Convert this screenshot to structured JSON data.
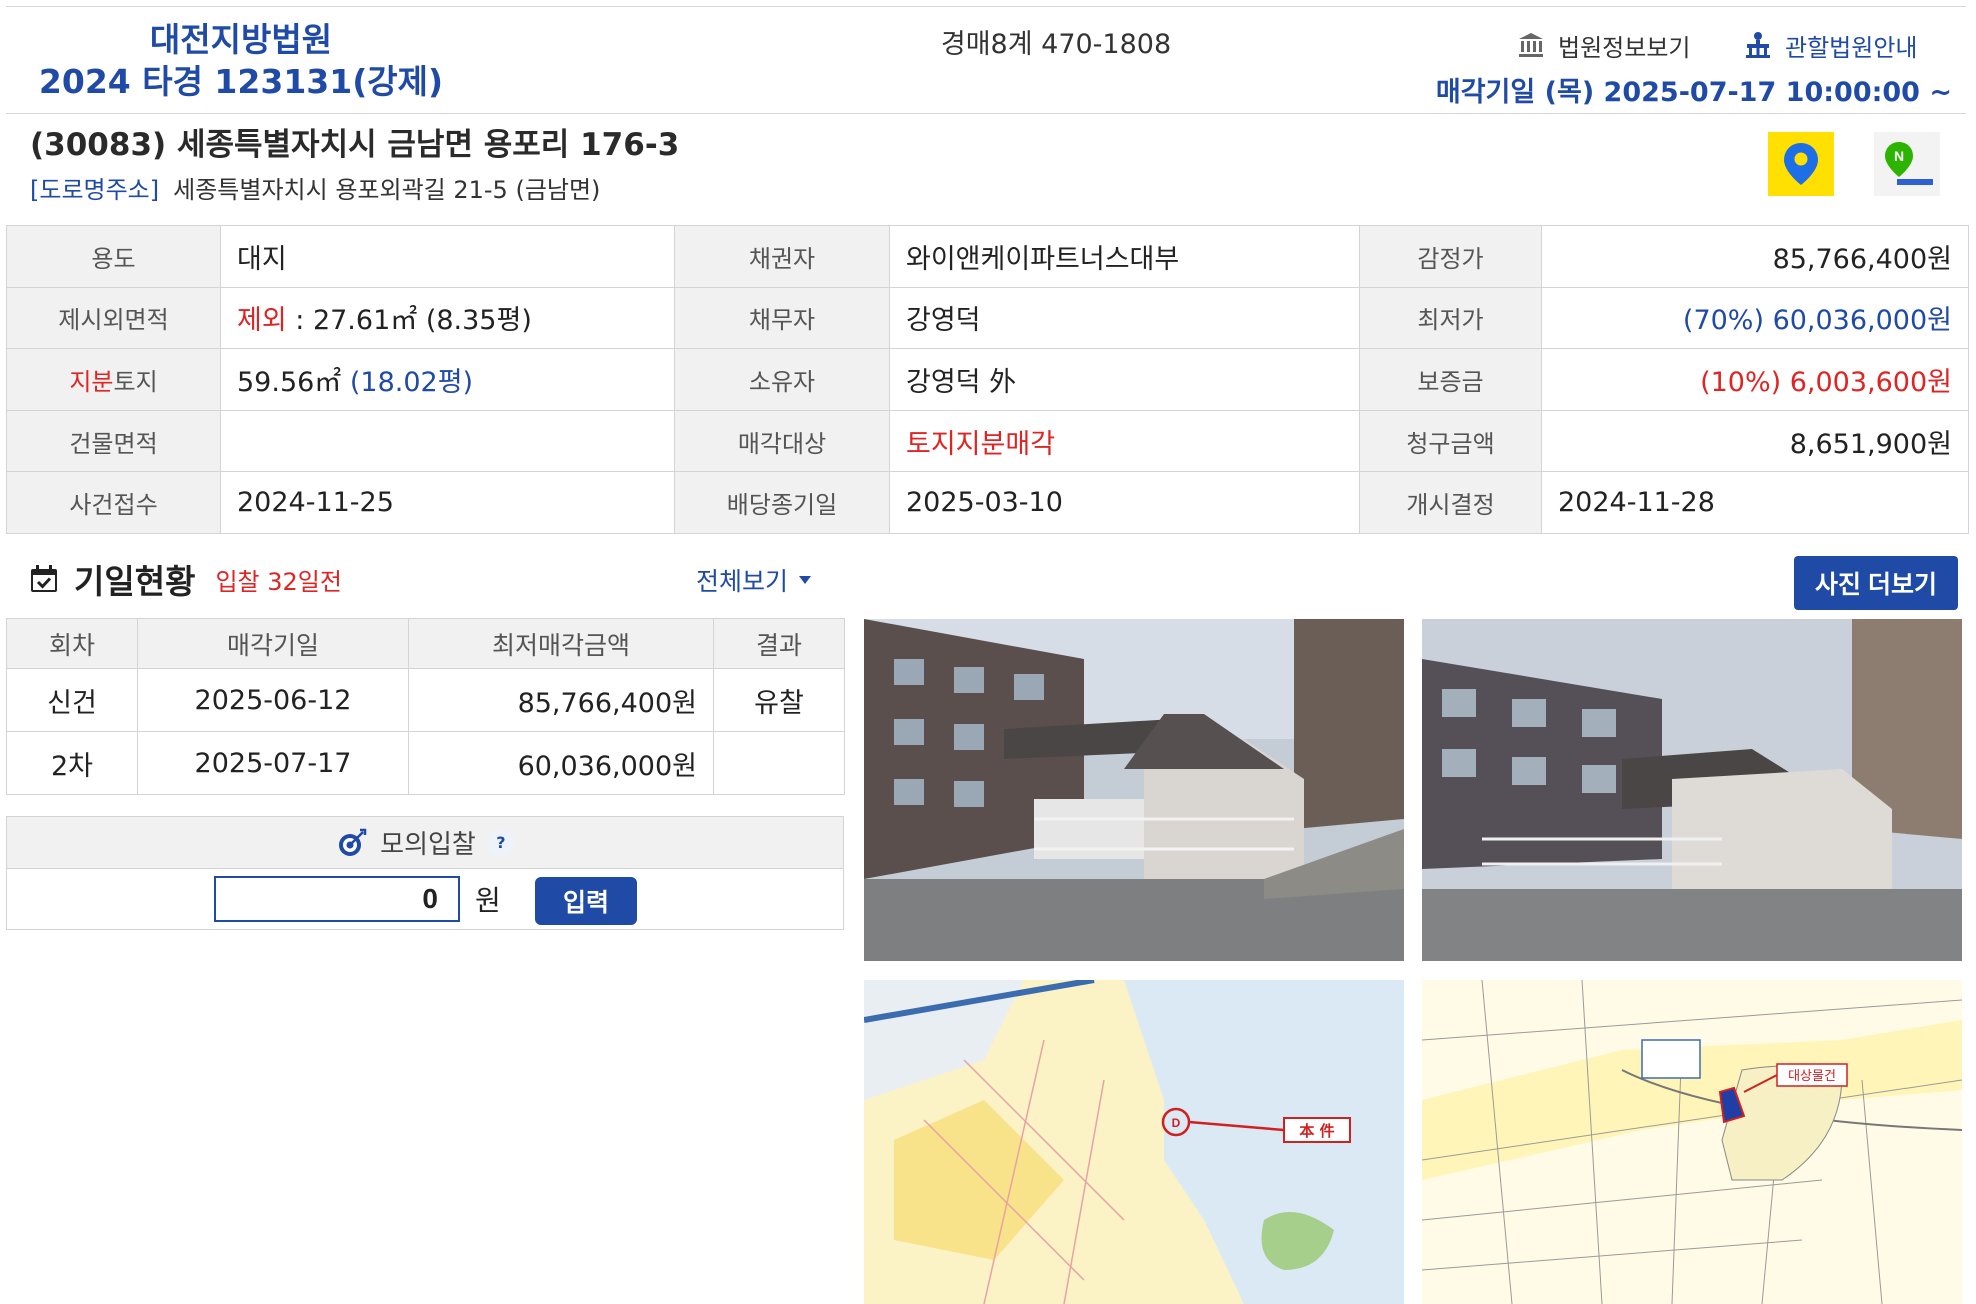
{
  "header": {
    "court": "대전지방법원",
    "case_no": "2024 타경 123131(강제)",
    "dept": "경매8계 470-1808",
    "court_info_label": "법원정보보기",
    "court_guide_label": "관할법원안내",
    "sale_date": "매각기일  (목) 2025-07-17 10:00:00 ~"
  },
  "address": {
    "main": "(30083) 세종특별자치시 금남면 용포리 176-3",
    "road_label": "[도로명주소]",
    "road": "세종특별자치시 용포외곽길 21-5 (금남면)",
    "kakao_map": "kakao-map-pin-icon",
    "naver_map": "naver-map-icon"
  },
  "info": {
    "r1": {
      "l1": "용도",
      "v1": "대지",
      "l2": "채권자",
      "v2": "와이앤케이파트너스대부",
      "l3": "감정가",
      "v3": "85,766,400원"
    },
    "r2": {
      "l1": "제시외면적",
      "v1_pre": "제외",
      "v1_post": " : 27.61㎡ (8.35평)",
      "l2": "채무자",
      "v2": "강영덕",
      "l3": "최저가",
      "v3": "(70%) 60,036,000원"
    },
    "r3": {
      "l1_red": "지분",
      "l1_rest": "토지",
      "v1_pre": "59.56㎡ ",
      "v1_post": "(18.02평)",
      "l2": "소유자",
      "v2": "강영덕 外",
      "l3": "보증금",
      "v3": "(10%) 6,003,600원"
    },
    "r4": {
      "l1": "건물면적",
      "v1": "",
      "l2": "매각대상",
      "v2": "토지지분매각",
      "l3": "청구금액",
      "v3": "8,651,900원"
    },
    "r5": {
      "l1": "사건접수",
      "v1": "2024-11-25",
      "l2": "배당종기일",
      "v2": "2025-03-10",
      "l3": "개시결정",
      "v3": "2024-11-28"
    }
  },
  "schedule": {
    "title": "기일현황",
    "subtitle": "입찰 32일전",
    "view_all": "전체보기",
    "photo_more": "사진 더보기",
    "columns": [
      "회차",
      "매각기일",
      "최저매각금액",
      "결과"
    ],
    "rows": [
      [
        "신건",
        "2025-06-12",
        "85,766,400원",
        "유찰"
      ],
      [
        "2차",
        "2025-07-17",
        "60,036,000원",
        ""
      ]
    ]
  },
  "mock_bid": {
    "title": "모의입찰",
    "help": "?",
    "value": "0",
    "unit": "원",
    "submit": "입력"
  },
  "maps": {
    "location_label": "本  件",
    "target_label": "대상물건"
  },
  "colors": {
    "accent": "#1f4aa6",
    "alert": "#e02424",
    "label_bg": "#f1f1f1"
  }
}
